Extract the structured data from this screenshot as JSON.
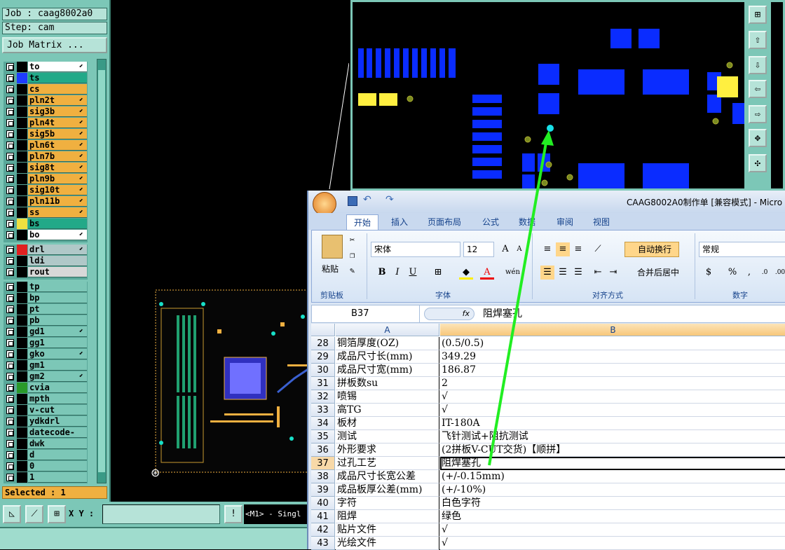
{
  "cam": {
    "job_label": "Job : caag8002a0",
    "step_label": "Step: cam",
    "job_matrix": "Job Matrix ...",
    "layers_top": [
      {
        "name": "to",
        "color": "#ffffff",
        "swatch": "#000000",
        "arrow": true
      },
      {
        "name": "ts",
        "color": "#22a988",
        "swatch": "#1e3cff",
        "arrow": false
      },
      {
        "name": "cs",
        "color": "#f0b040",
        "swatch": "#000000",
        "arrow": false
      },
      {
        "name": "pln2t",
        "color": "#f0b040",
        "swatch": "#000000",
        "arrow": true
      },
      {
        "name": "sig3b",
        "color": "#f0b040",
        "swatch": "#000000",
        "arrow": true
      },
      {
        "name": "pln4t",
        "color": "#f0b040",
        "swatch": "#000000",
        "arrow": true
      },
      {
        "name": "sig5b",
        "color": "#f0b040",
        "swatch": "#000000",
        "arrow": true
      },
      {
        "name": "pln6t",
        "color": "#f0b040",
        "swatch": "#000000",
        "arrow": true
      },
      {
        "name": "pln7b",
        "color": "#f0b040",
        "swatch": "#000000",
        "arrow": true
      },
      {
        "name": "sig8t",
        "color": "#f0b040",
        "swatch": "#000000",
        "arrow": true
      },
      {
        "name": "pln9b",
        "color": "#f0b040",
        "swatch": "#000000",
        "arrow": true
      },
      {
        "name": "sig10t",
        "color": "#f0b040",
        "swatch": "#000000",
        "arrow": true
      },
      {
        "name": "pln11b",
        "color": "#f0b040",
        "swatch": "#000000",
        "arrow": true
      },
      {
        "name": "ss",
        "color": "#f0b040",
        "swatch": "#000000",
        "arrow": true
      },
      {
        "name": "bs",
        "color": "#22a988",
        "swatch": "#f0e040",
        "arrow": false
      },
      {
        "name": "bo",
        "color": "#ffffff",
        "swatch": "#000000",
        "arrow": true
      }
    ],
    "layers_drill": [
      {
        "name": "drl",
        "color": "#b0c8c8",
        "swatch": "#e02020",
        "arrow": true
      },
      {
        "name": "ldi",
        "color": "#b0c8c8",
        "swatch": "#000000",
        "arrow": false
      },
      {
        "name": "rout",
        "color": "#d8d8d8",
        "swatch": "#000000",
        "arrow": false
      }
    ],
    "layers_misc": [
      {
        "name": "tp",
        "color": "#7cc7b7",
        "swatch": "#000000",
        "arrow": false
      },
      {
        "name": "bp",
        "color": "#7cc7b7",
        "swatch": "#000000",
        "arrow": false
      },
      {
        "name": "pt",
        "color": "#7cc7b7",
        "swatch": "#000000",
        "arrow": false
      },
      {
        "name": "pb",
        "color": "#7cc7b7",
        "swatch": "#000000",
        "arrow": false
      },
      {
        "name": "gd1",
        "color": "#7cc7b7",
        "swatch": "#000000",
        "arrow": true
      },
      {
        "name": "gg1",
        "color": "#7cc7b7",
        "swatch": "#000000",
        "arrow": false
      },
      {
        "name": "gko",
        "color": "#7cc7b7",
        "swatch": "#000000",
        "arrow": true
      },
      {
        "name": "gm1",
        "color": "#7cc7b7",
        "swatch": "#000000",
        "arrow": false
      },
      {
        "name": "gm2",
        "color": "#7cc7b7",
        "swatch": "#000000",
        "arrow": true
      },
      {
        "name": "cvia",
        "color": "#7cc7b7",
        "swatch": "#2a9a2a",
        "arrow": false
      },
      {
        "name": "mpth",
        "color": "#7cc7b7",
        "swatch": "#000000",
        "arrow": false
      },
      {
        "name": "v-cut",
        "color": "#7cc7b7",
        "swatch": "#000000",
        "arrow": false
      },
      {
        "name": "ydkdrl",
        "color": "#7cc7b7",
        "swatch": "#000000",
        "arrow": false
      },
      {
        "name": "datecode-pte",
        "color": "#7cc7b7",
        "swatch": "#000000",
        "arrow": false
      },
      {
        "name": "dwk",
        "color": "#7cc7b7",
        "swatch": "#000000",
        "arrow": false
      },
      {
        "name": "d",
        "color": "#7cc7b7",
        "swatch": "#000000",
        "arrow": false
      },
      {
        "name": "0",
        "color": "#7cc7b7",
        "swatch": "#000000",
        "arrow": false
      },
      {
        "name": "1",
        "color": "#7cc7b7",
        "swatch": "#000000",
        "arrow": false
      }
    ],
    "selected": "Selected : 1",
    "xy_label": "X Y :",
    "xy_value": "",
    "mode_text": "<M1> - Singl"
  },
  "excel": {
    "title": "CAAG8002A0制作单 [兼容模式] - Micro",
    "tabs": [
      "开始",
      "插入",
      "页面布局",
      "公式",
      "数据",
      "审阅",
      "视图"
    ],
    "paste_label": "粘贴",
    "clipboard_label": "剪贴板",
    "font_label": "字体",
    "align_label": "对齐方式",
    "number_label": "数字",
    "font_name": "宋体",
    "font_size": "12",
    "wrap_text": "自动换行",
    "merge_center": "合并后居中",
    "number_format": "常规",
    "name_box": "B37",
    "fx": "fx",
    "formula": "阻焊塞孔",
    "col_a": "A",
    "col_b": "B",
    "rows": [
      {
        "n": "28",
        "a": "铜箔厚度(OZ)",
        "b": "(0.5/0.5)"
      },
      {
        "n": "29",
        "a": "成品尺寸长(mm)",
        "b": "349.29"
      },
      {
        "n": "30",
        "a": "成品尺寸宽(mm)",
        "b": "186.87"
      },
      {
        "n": "31",
        "a": "拼板数su",
        "b": "2"
      },
      {
        "n": "32",
        "a": "喷锡",
        "b": "√"
      },
      {
        "n": "33",
        "a": "高TG",
        "b": "√"
      },
      {
        "n": "34",
        "a": "板材",
        "b": "IT-180A"
      },
      {
        "n": "35",
        "a": "测试",
        "b": "飞针测试+阻抗测试"
      },
      {
        "n": "36",
        "a": "外形要求",
        "b": "(2拼板V-CUT交货)【顺拼】"
      },
      {
        "n": "37",
        "a": "过孔工艺",
        "b": "阻焊塞孔"
      },
      {
        "n": "38",
        "a": "成品尺寸长宽公差",
        "b": "(+/-0.15mm)"
      },
      {
        "n": "39",
        "a": "成品板厚公差(mm)",
        "b": "(+/-10%)"
      },
      {
        "n": "40",
        "a": "字符",
        "b": "白色字符"
      },
      {
        "n": "41",
        "a": "阻焊",
        "b": "绿色"
      },
      {
        "n": "42",
        "a": "贴片文件",
        "b": "√"
      },
      {
        "n": "43",
        "a": "光绘文件",
        "b": "√"
      }
    ],
    "selected_row": "37"
  },
  "colors": {
    "cam_panel": "#7cc7b7",
    "pad_blue": "#0a2cff",
    "pad_yellow": "#ffef40",
    "arrow_green": "#22ee22"
  }
}
